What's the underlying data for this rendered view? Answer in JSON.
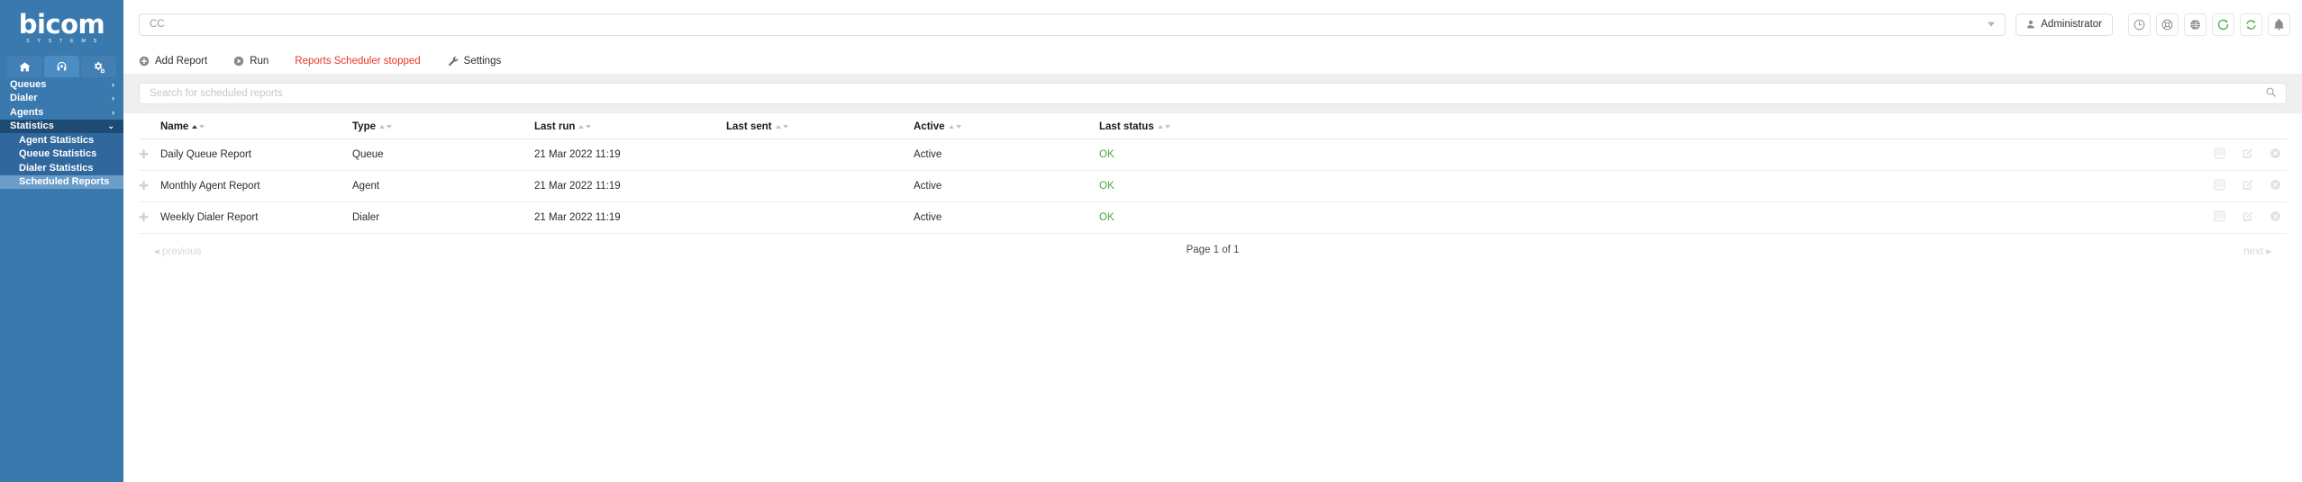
{
  "brand": {
    "name": "bicom",
    "tagline": "S Y S T E M S",
    "color": "#3a79ae"
  },
  "sidebar": {
    "tabs": [
      {
        "name": "home-tab",
        "icon": "home-icon",
        "active": false
      },
      {
        "name": "contact-center-tab",
        "icon": "headset-icon",
        "active": true
      },
      {
        "name": "settings-tab",
        "icon": "cogs-icon",
        "active": false
      }
    ],
    "items": [
      {
        "label": "Queues",
        "expandable": true,
        "expanded": false
      },
      {
        "label": "Dialer",
        "expandable": true,
        "expanded": false
      },
      {
        "label": "Agents",
        "expandable": true,
        "expanded": false
      },
      {
        "label": "Statistics",
        "expandable": true,
        "expanded": true
      }
    ],
    "sub_items": [
      {
        "label": "Agent Statistics",
        "selected": false
      },
      {
        "label": "Queue Statistics",
        "selected": false
      },
      {
        "label": "Dialer Statistics",
        "selected": false
      },
      {
        "label": "Scheduled Reports",
        "selected": true
      }
    ]
  },
  "topbar": {
    "cc_select_value": "CC",
    "admin_label": "Administrator",
    "icons": [
      {
        "name": "clock-icon",
        "color": "#8a8a8a"
      },
      {
        "name": "life-ring-icon",
        "color": "#8a8a8a"
      },
      {
        "name": "globe-icon",
        "color": "#8a8a8a"
      },
      {
        "name": "refresh-icon",
        "color": "#5cb85c"
      },
      {
        "name": "sync-icon",
        "color": "#5cb85c"
      },
      {
        "name": "bell-icon",
        "color": "#8a8a8a"
      }
    ]
  },
  "actionbar": {
    "add_report": "Add Report",
    "run": "Run",
    "scheduler_status": "Reports Scheduler stopped",
    "scheduler_status_color": "#e8352a",
    "settings": "Settings"
  },
  "search": {
    "placeholder": "Search for scheduled reports",
    "value": ""
  },
  "table": {
    "columns": [
      {
        "label": "Name",
        "sort": "asc"
      },
      {
        "label": "Type",
        "sort": "none"
      },
      {
        "label": "Last run",
        "sort": "none"
      },
      {
        "label": "Last sent",
        "sort": "none"
      },
      {
        "label": "Active",
        "sort": "none"
      },
      {
        "label": "Last status",
        "sort": "none"
      }
    ],
    "rows": [
      {
        "name": "Daily Queue Report",
        "type": "Queue",
        "last_run": "21 Mar 2022 11:19",
        "last_sent": "",
        "active": "Active",
        "last_status": "OK"
      },
      {
        "name": "Monthly Agent Report",
        "type": "Agent",
        "last_run": "21 Mar 2022 11:19",
        "last_sent": "",
        "active": "Active",
        "last_status": "OK"
      },
      {
        "name": "Weekly Dialer Report",
        "type": "Dialer",
        "last_run": "21 Mar 2022 11:19",
        "last_sent": "",
        "active": "Active",
        "last_status": "OK"
      }
    ],
    "row_actions": [
      {
        "name": "view-report-icon"
      },
      {
        "name": "edit-report-icon"
      },
      {
        "name": "delete-report-icon"
      }
    ],
    "status_ok_color": "#3fab3f"
  },
  "pager": {
    "previous": "previous",
    "page_info": "Page 1 of 1",
    "next": "next"
  }
}
